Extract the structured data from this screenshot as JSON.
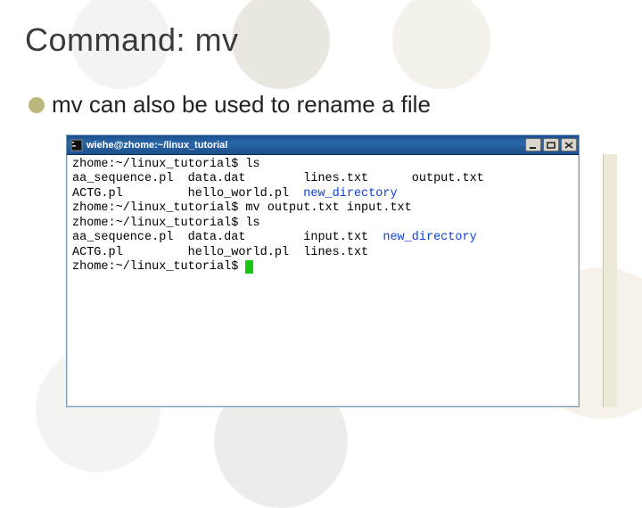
{
  "slide": {
    "title": "Command: mv",
    "bullet": "mv can also be used to rename a file"
  },
  "window": {
    "title": "wiehe@zhome:~/linux_tutorial"
  },
  "terminal": {
    "lines": [
      {
        "segments": [
          {
            "text": "zhome:~/linux_tutorial$ ls"
          }
        ]
      },
      {
        "segments": [
          {
            "text": "aa_sequence.pl  data.dat        lines.txt      output.txt"
          }
        ]
      },
      {
        "segments": [
          {
            "text": "ACTG.pl         hello_world.pl  "
          },
          {
            "text": "new_directory",
            "class": "blue"
          }
        ]
      },
      {
        "segments": [
          {
            "text": "zhome:~/linux_tutorial$ mv output.txt input.txt"
          }
        ]
      },
      {
        "segments": [
          {
            "text": "zhome:~/linux_tutorial$ ls"
          }
        ]
      },
      {
        "segments": [
          {
            "text": "aa_sequence.pl  data.dat        input.txt  "
          },
          {
            "text": "new_directory",
            "class": "blue"
          }
        ]
      },
      {
        "segments": [
          {
            "text": "ACTG.pl         hello_world.pl  lines.txt"
          }
        ]
      },
      {
        "segments": [
          {
            "text": "zhome:~/linux_tutorial$ "
          },
          {
            "cursor": true
          }
        ]
      }
    ]
  }
}
